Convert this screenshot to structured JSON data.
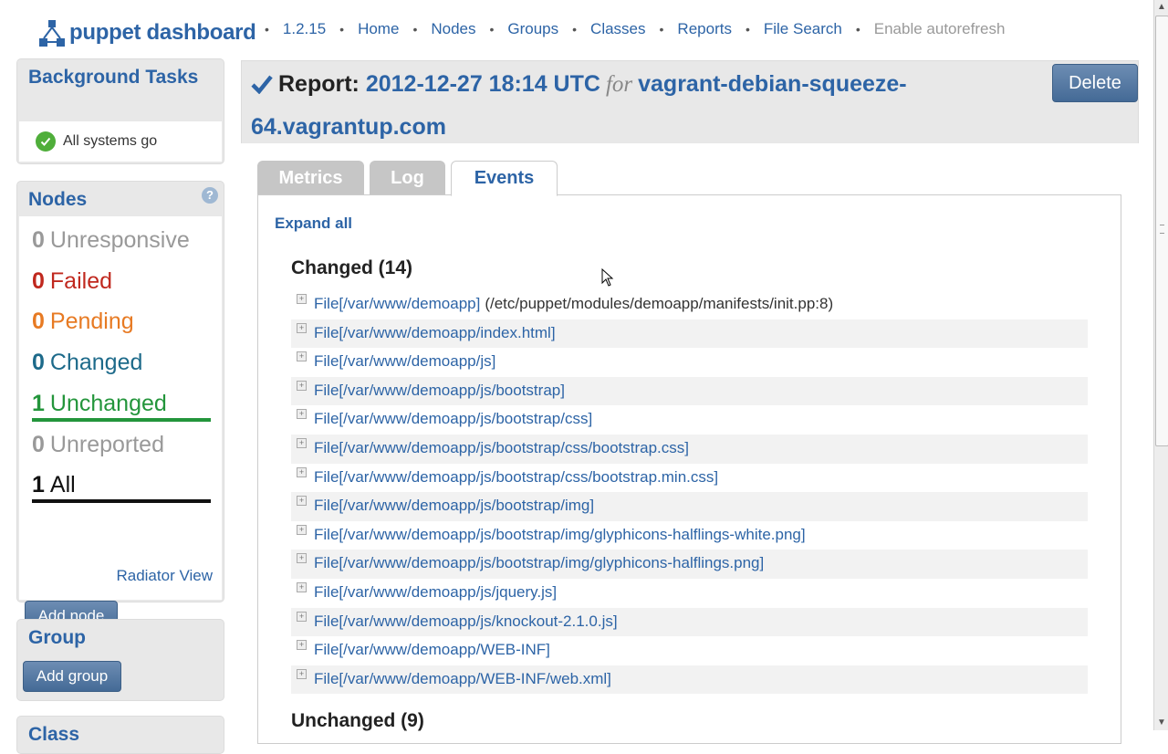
{
  "header": {
    "logo_text": "puppet dashboard",
    "nav": [
      {
        "label": "1.2.15",
        "enabled": true
      },
      {
        "label": "Home",
        "enabled": true
      },
      {
        "label": "Nodes",
        "enabled": true
      },
      {
        "label": "Groups",
        "enabled": true
      },
      {
        "label": "Classes",
        "enabled": true
      },
      {
        "label": "Reports",
        "enabled": true
      },
      {
        "label": "File Search",
        "enabled": true
      },
      {
        "label": "Enable autorefresh",
        "enabled": false
      }
    ],
    "separator": "•"
  },
  "sidebar": {
    "background_tasks": {
      "title": "Background Tasks",
      "status": "All systems go"
    },
    "nodes": {
      "title": "Nodes",
      "help_glyph": "?",
      "stats": [
        {
          "count": "0",
          "label": "Unresponsive",
          "color": "#999999"
        },
        {
          "count": "0",
          "label": "Failed",
          "color": "#c0281e"
        },
        {
          "count": "0",
          "label": "Pending",
          "color": "#e77a23"
        },
        {
          "count": "0",
          "label": "Changed",
          "color": "#1d6a8a"
        },
        {
          "count": "1",
          "label": "Unchanged",
          "color": "#23953b"
        },
        {
          "count": "0",
          "label": "Unreported",
          "color": "#999999"
        },
        {
          "count": "1",
          "label": "All",
          "color": "#111111"
        }
      ],
      "radiator_link": "Radiator View",
      "add_button": "Add node"
    },
    "group": {
      "title": "Group",
      "add_button": "Add group"
    },
    "classes": {
      "title": "Class"
    }
  },
  "report": {
    "title_prefix": "Report:",
    "timestamp": "2012-12-27 18:14 UTC",
    "for_word": "for",
    "node": "vagrant-debian-squeeze-64.vagrantup.com",
    "delete_button": "Delete",
    "tabs": [
      {
        "label": "Metrics",
        "active": false
      },
      {
        "label": "Log",
        "active": false
      },
      {
        "label": "Events",
        "active": true
      }
    ],
    "expand_all": "Expand all",
    "changed_heading": "Changed (14)",
    "changed_events": [
      {
        "resource": "File[/var/www/demoapp]",
        "source": "(/etc/puppet/modules/demoapp/manifests/init.pp:8)"
      },
      {
        "resource": "File[/var/www/demoapp/index.html]",
        "source": ""
      },
      {
        "resource": "File[/var/www/demoapp/js]",
        "source": ""
      },
      {
        "resource": "File[/var/www/demoapp/js/bootstrap]",
        "source": ""
      },
      {
        "resource": "File[/var/www/demoapp/js/bootstrap/css]",
        "source": ""
      },
      {
        "resource": "File[/var/www/demoapp/js/bootstrap/css/bootstrap.css]",
        "source": ""
      },
      {
        "resource": "File[/var/www/demoapp/js/bootstrap/css/bootstrap.min.css]",
        "source": ""
      },
      {
        "resource": "File[/var/www/demoapp/js/bootstrap/img]",
        "source": ""
      },
      {
        "resource": "File[/var/www/demoapp/js/bootstrap/img/glyphicons-halflings-white.png]",
        "source": ""
      },
      {
        "resource": "File[/var/www/demoapp/js/bootstrap/img/glyphicons-halflings.png]",
        "source": ""
      },
      {
        "resource": "File[/var/www/demoapp/js/jquery.js]",
        "source": ""
      },
      {
        "resource": "File[/var/www/demoapp/js/knockout-2.1.0.js]",
        "source": ""
      },
      {
        "resource": "File[/var/www/demoapp/WEB-INF]",
        "source": ""
      },
      {
        "resource": "File[/var/www/demoapp/WEB-INF/web.xml]",
        "source": ""
      }
    ],
    "unchanged_heading": "Unchanged (9)"
  },
  "scrollbar": {
    "position": 0.0
  }
}
